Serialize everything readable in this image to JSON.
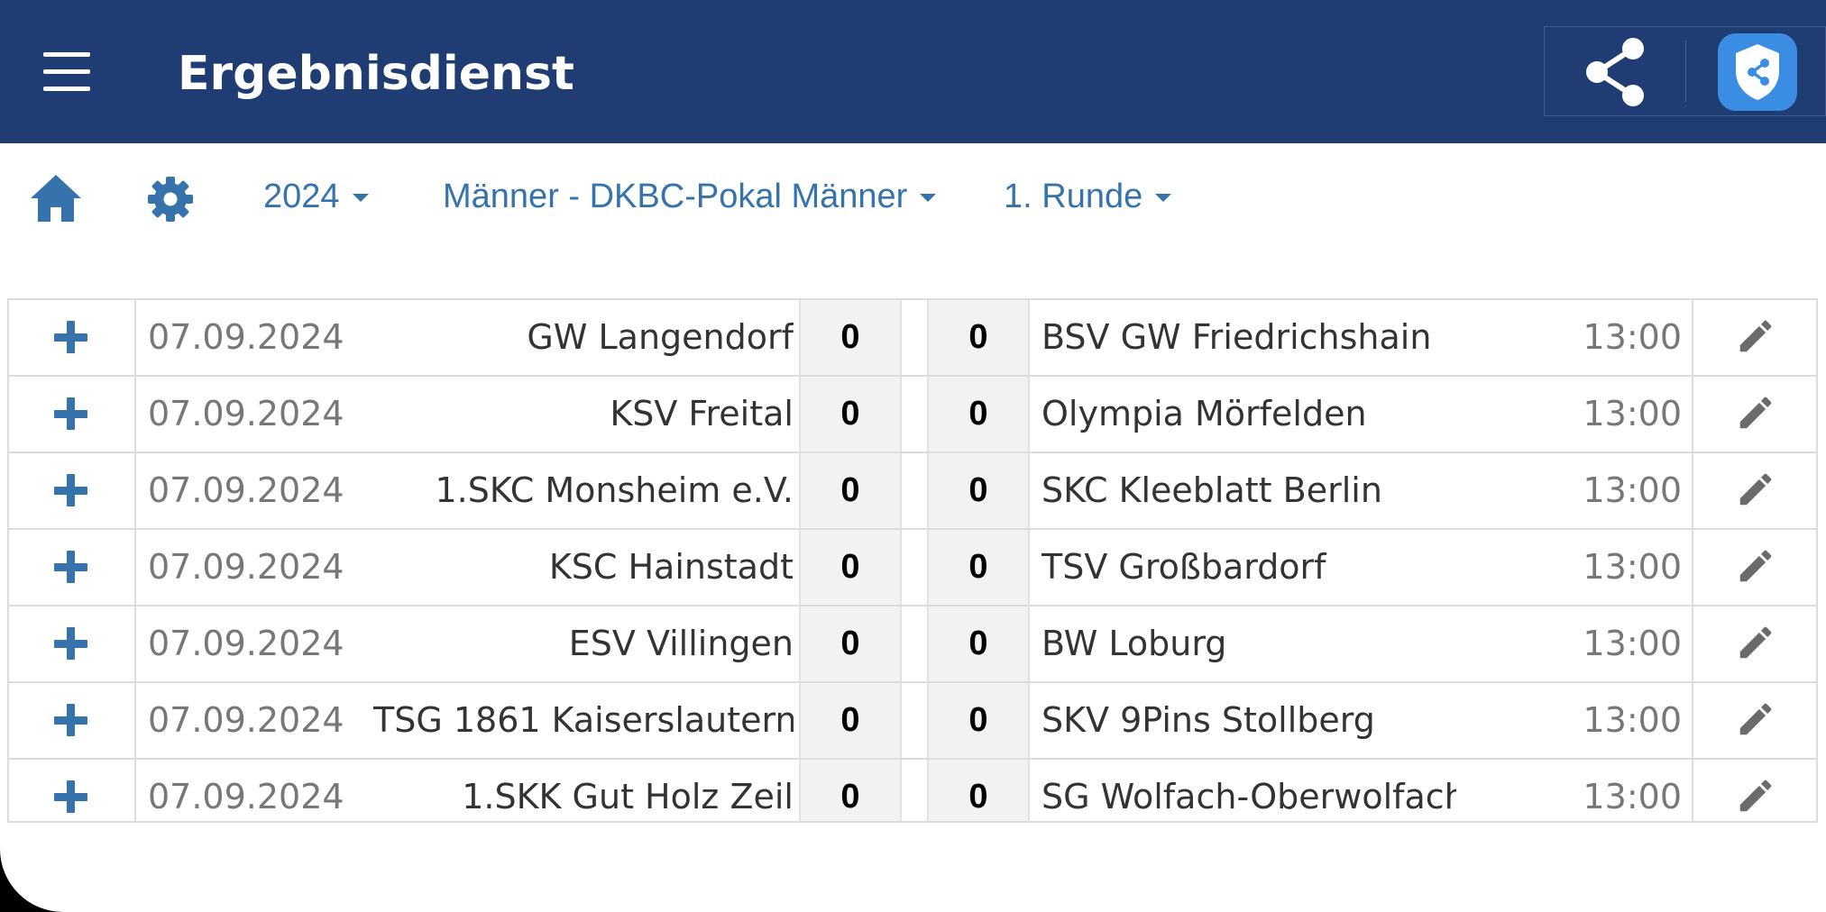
{
  "app_bar": {
    "title": "Ergebnisdienst",
    "menu_icon": "hamburger-menu-icon",
    "share_icon": "share-icon",
    "shield_icon": "shield-share-icon",
    "background_color": "#1f3c73"
  },
  "filters": {
    "home_icon": "home-icon",
    "settings_icon": "gear-icon",
    "season": "2024",
    "competition": "Männer - DKBC-Pokal Männer",
    "round": "1. Runde",
    "accent_color": "#3673ad"
  },
  "matches": [
    {
      "date": "07.09.2024",
      "home": "GW Langendorf",
      "home_score": "0",
      "guest_score": "0",
      "guest": "BSV GW Friedrichshain",
      "time": "13:00"
    },
    {
      "date": "07.09.2024",
      "home": "KSV Freital",
      "home_score": "0",
      "guest_score": "0",
      "guest": "Olympia Mörfelden",
      "time": "13:00"
    },
    {
      "date": "07.09.2024",
      "home": "1.SKC Monsheim e.V.",
      "home_score": "0",
      "guest_score": "0",
      "guest": "SKC Kleeblatt Berlin",
      "time": "13:00"
    },
    {
      "date": "07.09.2024",
      "home": "KSC Hainstadt",
      "home_score": "0",
      "guest_score": "0",
      "guest": "TSV Großbardorf",
      "time": "13:00"
    },
    {
      "date": "07.09.2024",
      "home": "ESV Villingen",
      "home_score": "0",
      "guest_score": "0",
      "guest": "BW Loburg",
      "time": "13:00"
    },
    {
      "date": "07.09.2024",
      "home": "TSG 1861 Kaiserslautern",
      "home_score": "0",
      "guest_score": "0",
      "guest": "SKV 9Pins Stollberg",
      "time": "13:00"
    },
    {
      "date": "07.09.2024",
      "home": "1.SKK Gut Holz Zeil",
      "home_score": "0",
      "guest_score": "0",
      "guest": "SG Wolfach-Oberwolfach",
      "time": "13:00"
    }
  ]
}
